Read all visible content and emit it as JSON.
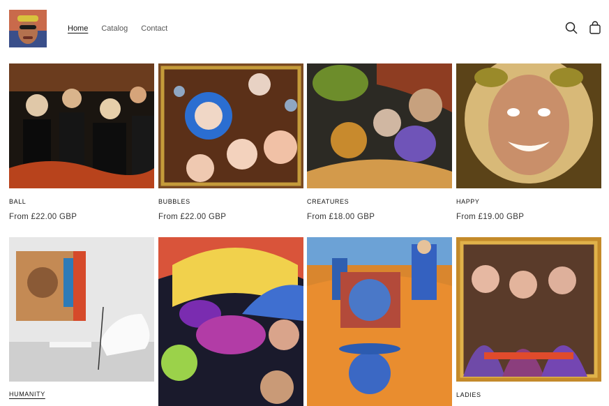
{
  "header": {
    "nav": [
      {
        "label": "Home",
        "active": true
      },
      {
        "label": "Catalog",
        "active": false
      },
      {
        "label": "Contact",
        "active": false
      }
    ],
    "icons": {
      "search": "search-icon",
      "cart": "cart-icon",
      "logo": "store-logo"
    }
  },
  "products": [
    {
      "title": "BALL",
      "price": "From £22.00 GBP"
    },
    {
      "title": "BUBBLES",
      "price": "From £22.00 GBP"
    },
    {
      "title": "CREATURES",
      "price": "From £18.00 GBP"
    },
    {
      "title": "HAPPY",
      "price": "From £19.00 GBP"
    },
    {
      "title": "HUMANITY",
      "price": ""
    },
    {
      "title": "",
      "price": ""
    },
    {
      "title": "",
      "price": ""
    },
    {
      "title": "LADIES",
      "price": ""
    }
  ],
  "colors": {
    "text": "#121212",
    "muted": "#555555",
    "background": "#ffffff"
  }
}
